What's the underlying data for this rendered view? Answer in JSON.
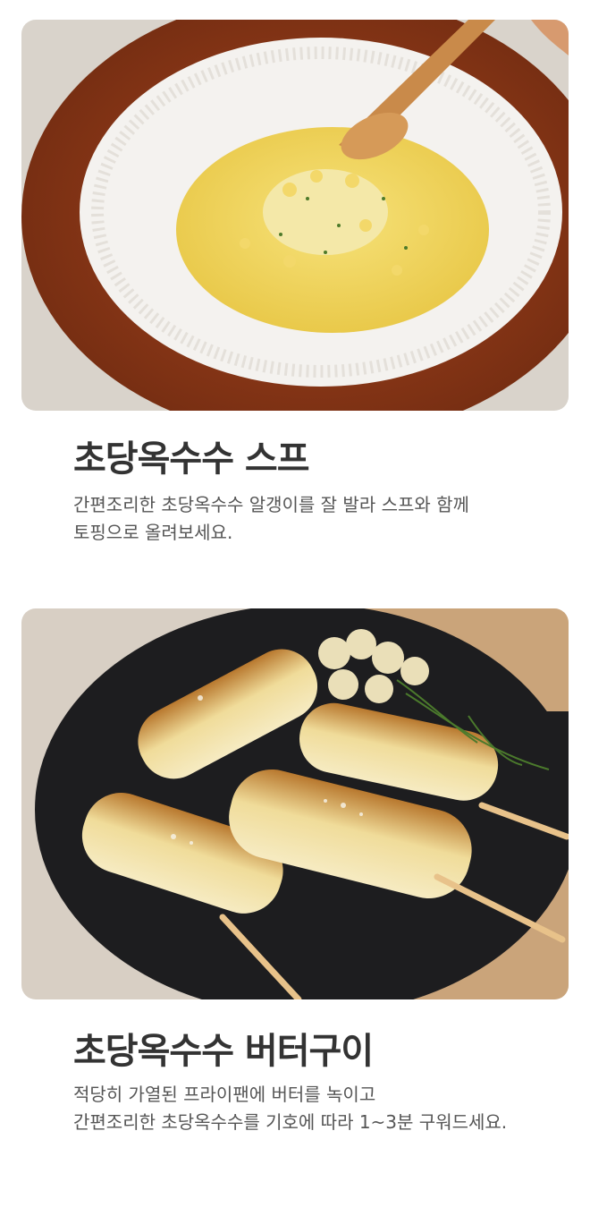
{
  "recipes": [
    {
      "title": "초당옥수수 스프",
      "description_lines": [
        "간편조리한 초당옥수수 알갱이를 잘 발라 스프와 함께",
        "토핑으로 올려보세요."
      ],
      "photo": "corn-soup-photo"
    },
    {
      "title": "초당옥수수 버터구이",
      "description_lines": [
        "적당히 가열된 프라이팬에 버터를 녹이고",
        "간편조리한 초당옥수수를 기호에 따라 1~3분 구워드세요."
      ],
      "photo": "butter-grilled-corn-photo"
    }
  ]
}
